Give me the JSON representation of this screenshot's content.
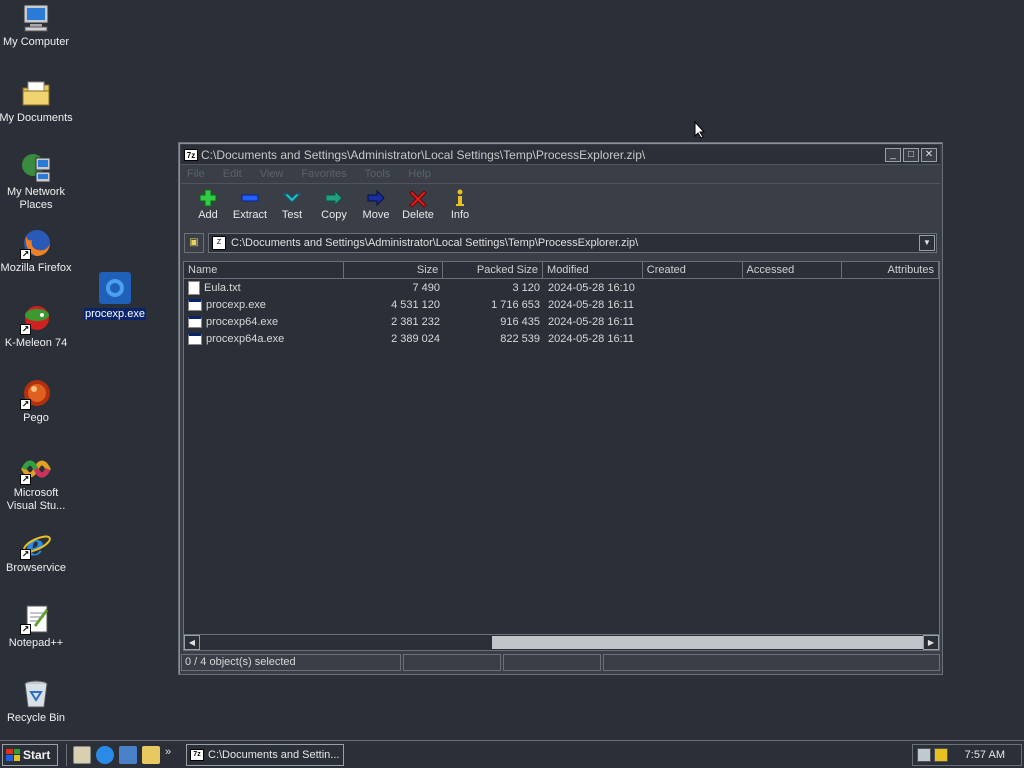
{
  "desktop": {
    "icons": [
      {
        "label": "My Computer",
        "icon": "computer-icon"
      },
      {
        "label": "My Documents",
        "icon": "folder-icon"
      },
      {
        "label": "My Network Places",
        "icon": "network-icon"
      },
      {
        "label": "Mozilla Firefox",
        "icon": "firefox-icon"
      },
      {
        "label": "K-Meleon 74",
        "icon": "kmeleon-icon"
      },
      {
        "label": "Pego",
        "icon": "pego-icon"
      },
      {
        "label": "Microsoft Visual Stu...",
        "icon": "visual-studio-icon"
      },
      {
        "label": "Browservice",
        "icon": "ie-icon"
      },
      {
        "label": "Notepad++",
        "icon": "notepad-icon"
      },
      {
        "label": "Recycle Bin",
        "icon": "recycle-bin-icon"
      }
    ],
    "selected_file": {
      "label": "procexp.exe",
      "icon": "procexp-icon"
    }
  },
  "window": {
    "title": "C:\\Documents and Settings\\Administrator\\Local Settings\\Temp\\ProcessExplorer.zip\\",
    "app_icon_text": "7z",
    "menu": [
      "File",
      "Edit",
      "View",
      "Favorites",
      "Tools",
      "Help"
    ],
    "toolbar": [
      {
        "label": "Add",
        "icon": "add-icon",
        "color": "#2ecc40"
      },
      {
        "label": "Extract",
        "icon": "extract-icon",
        "color": "#2060ff"
      },
      {
        "label": "Test",
        "icon": "test-icon",
        "color": "#20c8d0"
      },
      {
        "label": "Copy",
        "icon": "copy-icon",
        "color": "#20a080"
      },
      {
        "label": "Move",
        "icon": "move-icon",
        "color": "#1830a0"
      },
      {
        "label": "Delete",
        "icon": "delete-icon",
        "color": "#e02020"
      },
      {
        "label": "Info",
        "icon": "info-icon",
        "color": "#e8c020"
      }
    ],
    "address": "C:\\Documents and Settings\\Administrator\\Local Settings\\Temp\\ProcessExplorer.zip\\",
    "columns": [
      "Name",
      "Size",
      "Packed Size",
      "Modified",
      "Created",
      "Accessed",
      "Attributes"
    ],
    "files": [
      {
        "name": "Eula.txt",
        "type": "txt",
        "size": "7 490",
        "packed": "3 120",
        "modified": "2024-05-28 16:10"
      },
      {
        "name": "procexp.exe",
        "type": "exe",
        "size": "4 531 120",
        "packed": "1 716 653",
        "modified": "2024-05-28 16:11"
      },
      {
        "name": "procexp64.exe",
        "type": "exe",
        "size": "2 381 232",
        "packed": "916 435",
        "modified": "2024-05-28 16:11"
      },
      {
        "name": "procexp64a.exe",
        "type": "exe",
        "size": "2 389 024",
        "packed": "822 539",
        "modified": "2024-05-28 16:11"
      }
    ],
    "status": "0 / 4 object(s) selected"
  },
  "taskbar": {
    "start_label": "Start",
    "task_title": "C:\\Documents and Settin...",
    "quicklaunch_more": "»",
    "clock": "7:57 AM"
  }
}
